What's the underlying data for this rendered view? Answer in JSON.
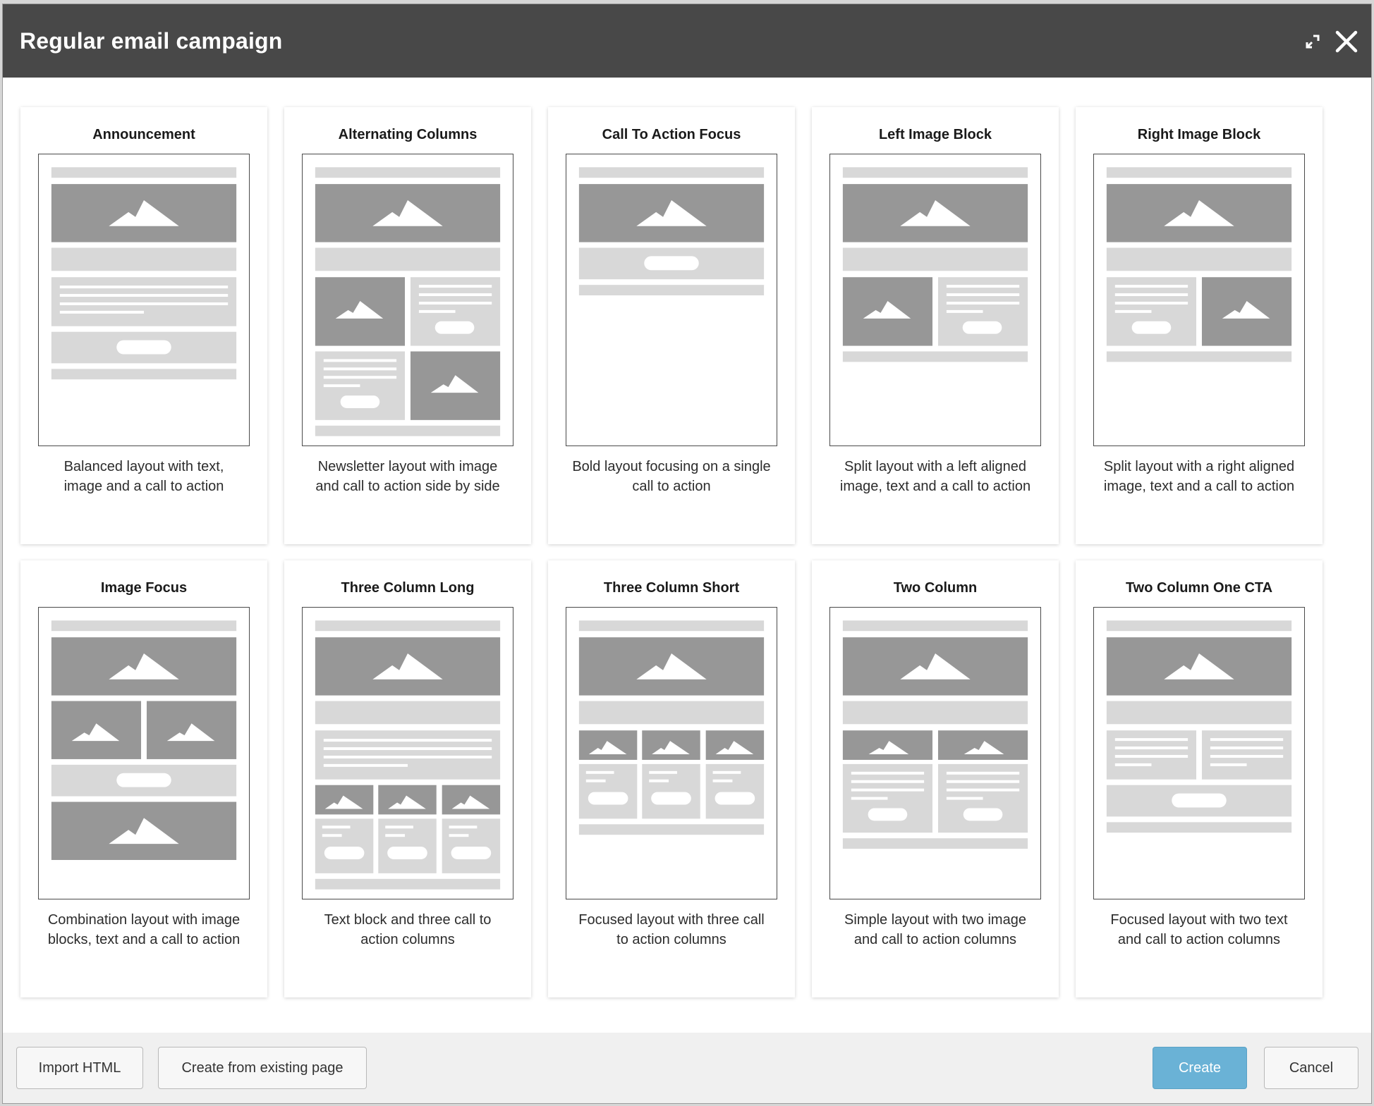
{
  "dialog": {
    "title": "Regular email campaign",
    "expand_icon": "expand-icon",
    "close_icon": "close-icon"
  },
  "templates": [
    {
      "title": "Announcement",
      "desc1": "Balanced layout with text,",
      "desc2": "image and a call to action"
    },
    {
      "title": "Alternating Columns",
      "desc1": "Newsletter layout with image",
      "desc2": "and call to action side by side"
    },
    {
      "title": "Call To Action Focus",
      "desc1": "Bold layout focusing on a single",
      "desc2": "call to action"
    },
    {
      "title": "Left Image Block",
      "desc1": "Split layout with a left aligned",
      "desc2": "image, text and a call to action"
    },
    {
      "title": "Right Image Block",
      "desc1": "Split layout with a right aligned",
      "desc2": "image, text and a call to action"
    },
    {
      "title": "Image Focus",
      "desc1": "Combination layout with image",
      "desc2": "blocks, text and a call to action"
    },
    {
      "title": "Three Column Long",
      "desc1": "Text block and three call to",
      "desc2": "action columns"
    },
    {
      "title": "Three Column Short",
      "desc1": "Focused layout with three call",
      "desc2": "to action columns"
    },
    {
      "title": "Two Column",
      "desc1": "Simple layout with two image",
      "desc2": "and call to action columns"
    },
    {
      "title": "Two Column One CTA",
      "desc1": "Focused layout with two text",
      "desc2": "and call to action columns"
    }
  ],
  "footer": {
    "import_html": "Import HTML",
    "create_from_existing": "Create from existing page",
    "create": "Create",
    "cancel": "Cancel"
  },
  "colors": {
    "titlebar": "#484848",
    "primary_button": "#6ab2d6",
    "thumb_dark": "#979797",
    "thumb_light": "#d8d8d8"
  }
}
